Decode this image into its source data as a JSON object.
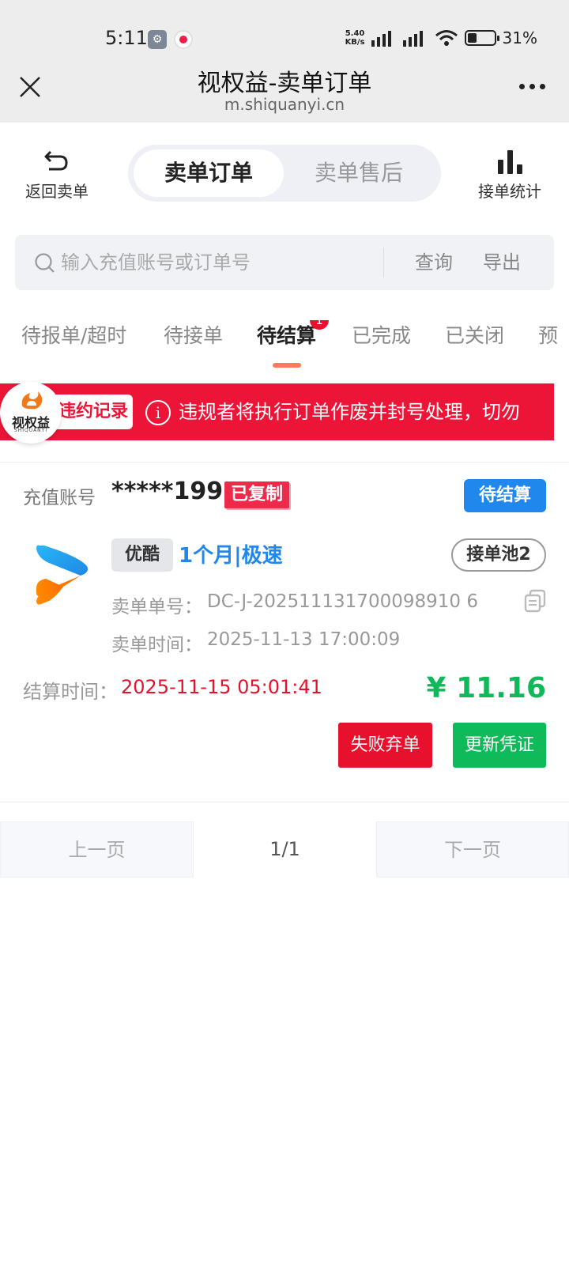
{
  "status_bar": {
    "time": "5:11",
    "speed_top": "5.40",
    "speed_bottom": "KB/s",
    "battery": "31%"
  },
  "browser": {
    "title": "视权益-卖单订单",
    "url": "m.shiquanyi.cn"
  },
  "header": {
    "back_label": "返回卖单",
    "tabs": [
      {
        "label": "卖单订单",
        "active": true
      },
      {
        "label": "卖单售后",
        "active": false
      }
    ],
    "stats_label": "接单统计"
  },
  "search": {
    "placeholder": "输入充值账号或订单号",
    "value": "",
    "query_label": "查询",
    "export_label": "导出"
  },
  "status_tabs": [
    {
      "label": "待报单/超时"
    },
    {
      "label": "待接单"
    },
    {
      "label": "待结算",
      "badge": "1",
      "active": true
    },
    {
      "label": "已完成"
    },
    {
      "label": "已关闭"
    },
    {
      "label": "预"
    }
  ],
  "notice": {
    "record_label": "违约记录",
    "info_icon": "i",
    "text": "违规者将执行订单作废并封号处理，切勿"
  },
  "logo": {
    "text": "视权益",
    "sub": "SHIQUANYI"
  },
  "order": {
    "account_label": "充值账号",
    "account_value": "*****199",
    "copied_tag": "已复制",
    "status": "待结算",
    "platform": "优酷",
    "product": "1个月|极速",
    "pool": "接单池2",
    "order_no_label": "卖单单号：",
    "order_no": "DC-J-202511131700098910 6",
    "order_time_label": "卖单时间：",
    "order_time": "2025-11-13 17:00:09",
    "settle_label": "结算时间：",
    "settle_time": "2025-11-15 05:01:41",
    "price": "¥ 11.16",
    "fail_button": "失败弃单",
    "update_button": "更新凭证"
  },
  "pager": {
    "prev": "上一页",
    "current": "1/1",
    "next": "下一页"
  },
  "colors": {
    "accent_blue": "#2087ec",
    "alert_red": "#e8112d",
    "success_green": "#10b85a",
    "tab_underline": "#ff7a5a"
  }
}
